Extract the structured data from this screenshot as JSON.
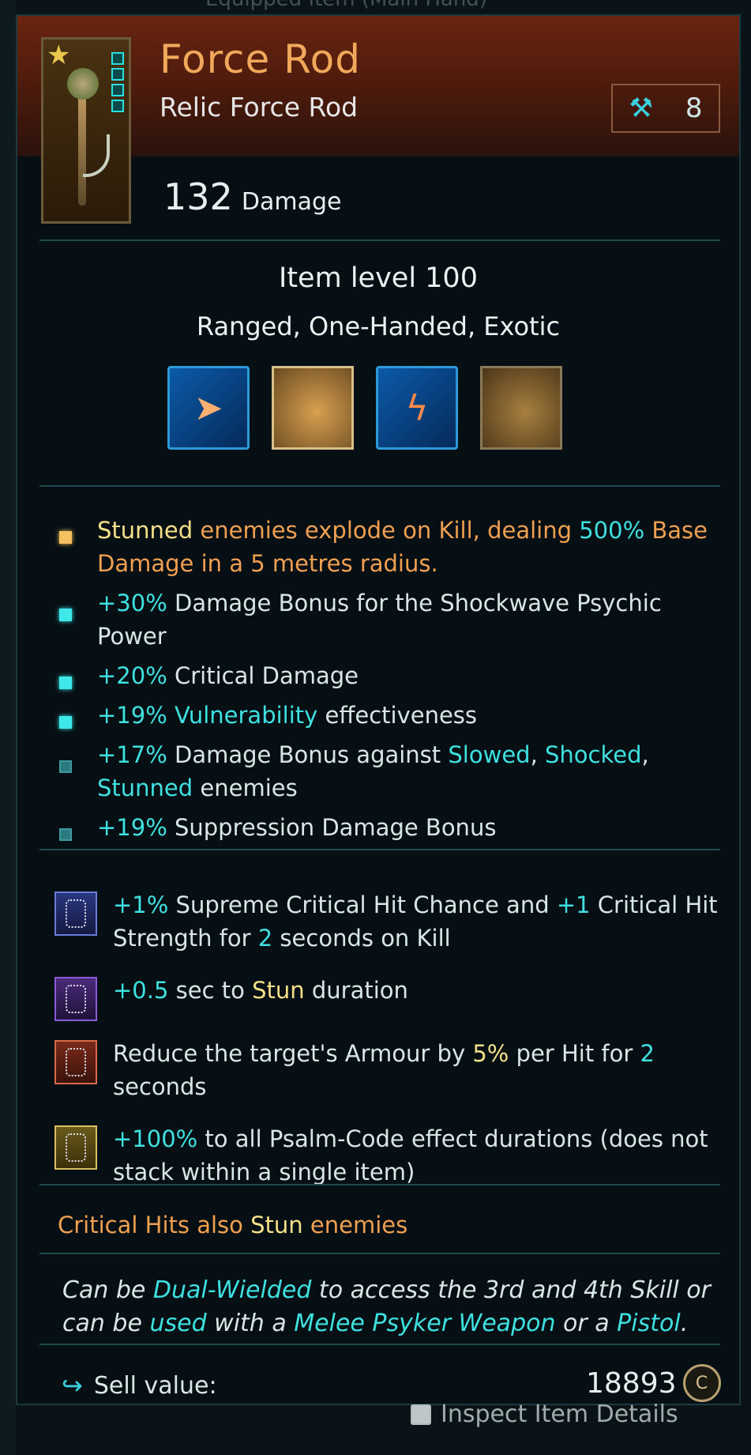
{
  "item": {
    "name": "Force Rod",
    "subtitle": "Relic Force Rod",
    "crafting_value": "8",
    "damage_value": "132",
    "damage_label": "Damage",
    "item_level": "Item level 100",
    "types": "Ranged, One-Handed, Exotic"
  },
  "skills": [
    {
      "name": "skill-blast-icon"
    },
    {
      "name": "skill-scroll-icon"
    },
    {
      "name": "skill-shockwave-icon"
    },
    {
      "name": "skill-scroll-icon-2"
    }
  ],
  "perks": [
    {
      "parts": [
        [
          "Stunned",
          "yellow"
        ],
        [
          " enemies explode on Kill, dealing ",
          "orange"
        ],
        [
          "500%",
          "cyan"
        ],
        [
          " Base Damage in a 5 metres radius.",
          "orange"
        ]
      ],
      "bullet": "gold"
    },
    {
      "parts": [
        [
          "+30%",
          "cyan"
        ],
        [
          " Damage Bonus for the Shockwave Psychic Power",
          "white"
        ]
      ],
      "bullet": "cyan"
    },
    {
      "parts": [
        [
          "+20%",
          "cyan"
        ],
        [
          " Critical Damage",
          "white"
        ]
      ],
      "bullet": "cyan"
    },
    {
      "parts": [
        [
          "+19% Vulnerability",
          "cyan"
        ],
        [
          " effectiveness",
          "white"
        ]
      ],
      "bullet": "cyan"
    },
    {
      "parts": [
        [
          "+17%",
          "cyan"
        ],
        [
          " Damage Bonus against ",
          "white"
        ],
        [
          "Slowed",
          "cyan"
        ],
        [
          ", ",
          "white"
        ],
        [
          "Shocked",
          "cyan"
        ],
        [
          ", ",
          "white"
        ],
        [
          "Stunned",
          "cyan"
        ],
        [
          " enemies",
          "white"
        ]
      ],
      "bullet": "dim"
    },
    {
      "parts": [
        [
          "+19%",
          "cyan"
        ],
        [
          " Suppression Damage Bonus",
          "white"
        ]
      ],
      "bullet": "dim"
    }
  ],
  "blessings": [
    {
      "color": "blue",
      "parts": [
        [
          "+1%",
          "cyan"
        ],
        [
          " Supreme Critical Hit Chance and ",
          "white"
        ],
        [
          "+1",
          "cyan"
        ],
        [
          " Critical Hit Strength for ",
          "white"
        ],
        [
          "2",
          "cyan"
        ],
        [
          " seconds on Kill",
          "white"
        ]
      ]
    },
    {
      "color": "purple",
      "parts": [
        [
          "+0.5",
          "cyan"
        ],
        [
          " sec to ",
          "white"
        ],
        [
          "Stun",
          "yellow"
        ],
        [
          " duration",
          "white"
        ]
      ]
    },
    {
      "color": "red",
      "parts": [
        [
          "Reduce the target's Armour by ",
          "white"
        ],
        [
          "5%",
          "yellow"
        ],
        [
          " per Hit for ",
          "white"
        ],
        [
          "2",
          "cyan"
        ],
        [
          " seconds",
          "white"
        ]
      ]
    },
    {
      "color": "yellow",
      "parts": [
        [
          "+100%",
          "cyan"
        ],
        [
          " to all Psalm-Code effect durations (does not stack within a single item)",
          "white"
        ]
      ]
    }
  ],
  "crit_line": [
    [
      "Critical Hits also ",
      "orange"
    ],
    [
      "Stun",
      "yellow"
    ],
    [
      " enemies",
      "orange"
    ]
  ],
  "description": [
    [
      "Can be ",
      "white"
    ],
    [
      "Dual-Wielded",
      "cyan"
    ],
    [
      " to access the 3rd and 4th Skill or can be ",
      "white"
    ],
    [
      "used",
      "cyan"
    ],
    [
      " with a ",
      "white"
    ],
    [
      "Melee Psyker Weapon",
      "cyan"
    ],
    [
      " or a ",
      "white"
    ],
    [
      "Pistol",
      "cyan"
    ],
    [
      ".",
      "white"
    ]
  ],
  "sell": {
    "label": "Sell value:",
    "value": "18893",
    "currency_symbol": "C"
  },
  "top_partial_text": "Equipped Item (Main Hand)",
  "bottom_partial_text": "Inspect Item Details"
}
